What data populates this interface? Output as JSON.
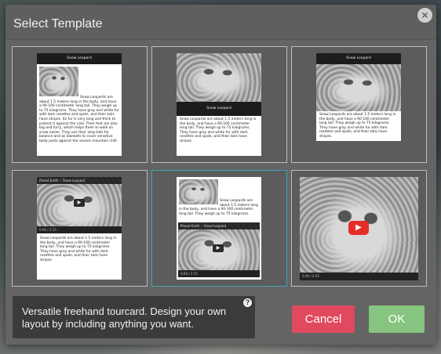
{
  "dialog": {
    "title": "Select Template",
    "close_glyph": "×",
    "description": "Versatile freehand tourcard. Design your own layout by including anything you want.",
    "help_glyph": "?",
    "cancel_label": "Cancel",
    "ok_label": "OK"
  },
  "templates": {
    "t1": {
      "heading": "Snow Leopard",
      "text": "Snow Leopards are about 1.5 meters long in the body, and have a 90-100 centimeter long tail. They weigh up to 75 kilograms. They have gray and white fur with dark rosettes and spots, and their tails have stripes. Its fur is very long and thick to protect it against the cold. Their feet are also big and furry, which helps them to walk on snow easier. They use their long tails for balance and as blankets to cover sensitive body parts against the severe mountain chill."
    },
    "t2": {
      "heading": "Snow Leopard",
      "text": "Snow Leopards are about 1.5 meters long in the body, and have a 90-100 centimeter long tail. They weigh up to 75 kilograms. They have gray and white fur with dark rosettes and spots, and their tails have stripes."
    },
    "t3": {
      "heading": "Snow Leopard",
      "text": "Snow Leopards are about 1.5 meters long in the body, and have a 90-100 centimeter long tail. They weigh up to 75 kilograms. They have gray and white fur with dark rosettes and spots, and their tails have stripes."
    },
    "t4": {
      "video_title": "Planet Earth -- Snow Leopard",
      "time": "0:00 / 2:15",
      "text": "Snow Leopards are about 1.5 meters long in the body, and have a 90-100 centimeter long tail. They weigh up to 75 kilograms. They have gray and white fur with dark rosettes and spots, and their tails have stripes."
    },
    "t5": {
      "text": "Snow Leopards are about 1.5 meters long in the body, and have a 90-100 centimeter long tail. They weigh up to 75 kilograms.",
      "video_title": "Planet Earth -- Snow Leopard",
      "time": "0:00 / 2:15"
    },
    "t6": {
      "time": "0:00 / 4:54"
    }
  },
  "colors": {
    "cancel": "#e0495e",
    "ok": "#86c47f",
    "selected_border": "#3aa6b7"
  }
}
